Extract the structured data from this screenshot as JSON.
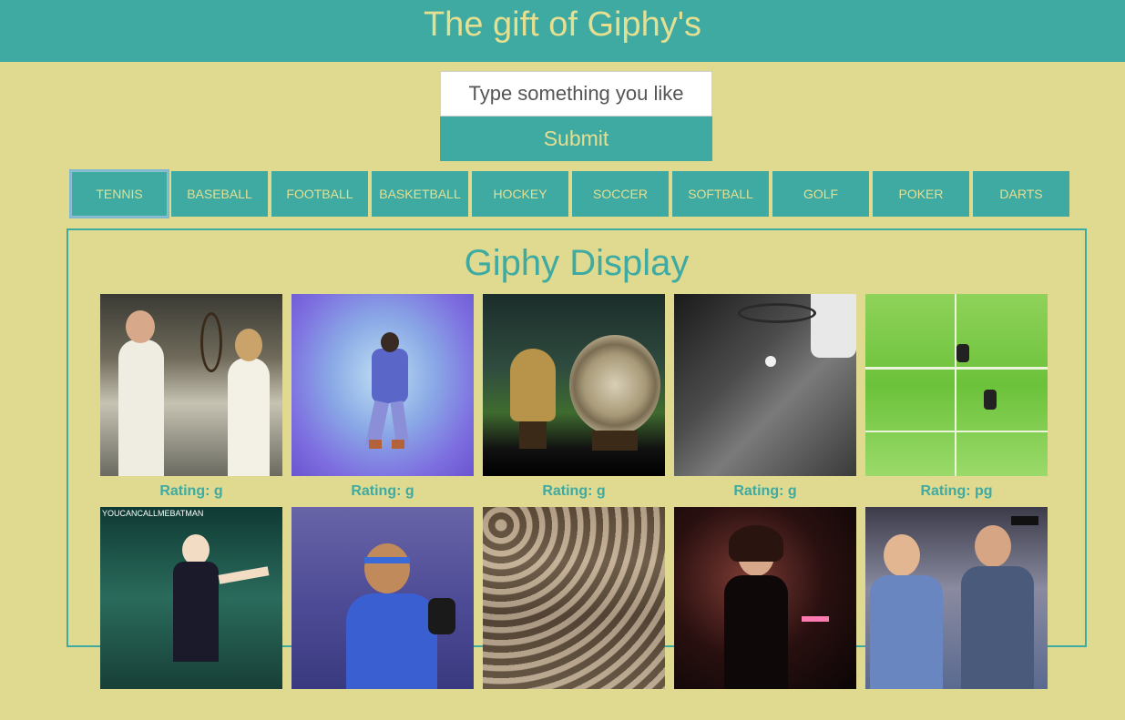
{
  "header": {
    "title": "The gift of Giphy's"
  },
  "search": {
    "placeholder": "Type something you like",
    "submit_label": "Submit"
  },
  "topics": [
    "TENNIS",
    "BASEBALL",
    "FOOTBALL",
    "BASKETBALL",
    "HOCKEY",
    "SOCCER",
    "SOFTBALL",
    "GOLF",
    "POKER",
    "DARTS"
  ],
  "active_topic": "TENNIS",
  "display": {
    "title": "Giphy Display",
    "gifs": [
      {
        "rating": "Rating: g",
        "subject": "tennis-players-image"
      },
      {
        "rating": "Rating: g",
        "subject": "dancing-man-image"
      },
      {
        "rating": "Rating: g",
        "subject": "wimbledon-trophies-image"
      },
      {
        "rating": "Rating: g",
        "subject": "tennis-serve-image"
      },
      {
        "rating": "Rating: pg",
        "subject": "tennis-court-image"
      },
      {
        "rating": "",
        "subject": "tennis-player-gesture-image",
        "overlay_text": "YOUCANCALLMEBATMAN"
      },
      {
        "rating": "",
        "subject": "tennis-player-headband-image"
      },
      {
        "rating": "",
        "subject": "crowd-stands-image"
      },
      {
        "rating": "",
        "subject": "woman-dark-background-image"
      },
      {
        "rating": "",
        "subject": "celebrating-men-image"
      }
    ]
  },
  "colors": {
    "background": "#dfda8f",
    "accent": "#3eaaa2",
    "accent_text": "#e5df92"
  }
}
